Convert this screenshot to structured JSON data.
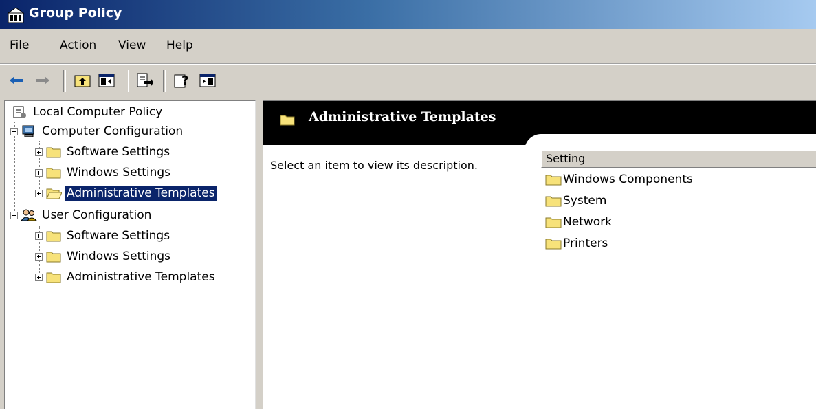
{
  "window": {
    "title": "Group Policy"
  },
  "menu": [
    "File",
    "Action",
    "View",
    "Help"
  ],
  "toolbar": {
    "buttons": [
      "back-arrow-icon",
      "forward-arrow-icon",
      "up-folder-icon",
      "show-hide-tree-icon",
      "export-list-icon",
      "help-icon",
      "action-pane-icon"
    ]
  },
  "tree": {
    "root": "Local Computer Policy",
    "computer_config": "Computer Configuration",
    "computer_children": [
      "Software Settings",
      "Windows Settings",
      "Administrative Templates"
    ],
    "user_config": "User Configuration",
    "user_children": [
      "Software Settings",
      "Windows Settings",
      "Administrative Templates"
    ]
  },
  "details": {
    "banner_title": "Administrative Templates",
    "description": "Select an item to view its description.",
    "column_header": "Setting",
    "items": [
      "Windows Components",
      "System",
      "Network",
      "Printers"
    ]
  },
  "colors": {
    "selection": "#0a246a",
    "folder": "#f7e27a",
    "chrome": "#d4d0c8"
  }
}
